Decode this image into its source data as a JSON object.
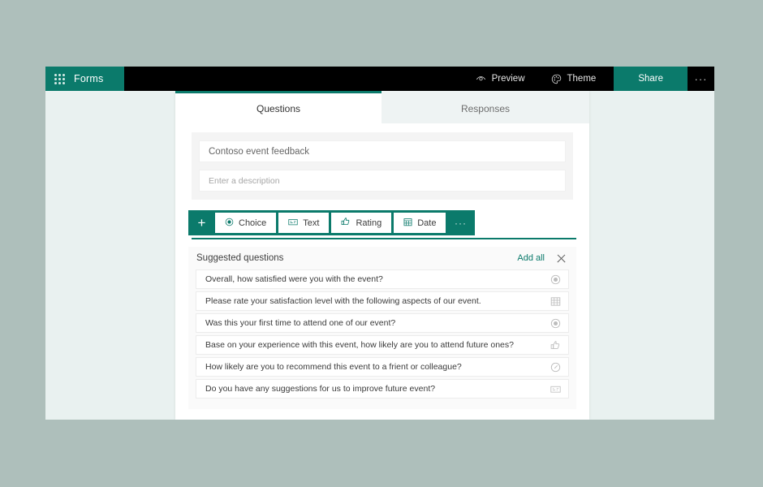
{
  "suite_bar": {
    "app_launcher_name": "waffle-icon",
    "brand": "Forms",
    "preview_label": "Preview",
    "theme_label": "Theme",
    "share_label": "Share",
    "more_label": "···"
  },
  "tabs": [
    {
      "label": "Questions",
      "active": true
    },
    {
      "label": "Responses",
      "active": false
    }
  ],
  "form": {
    "title": "Contoso event feedback",
    "description_placeholder": "Enter a description"
  },
  "question_toolbar": {
    "add_label": "+",
    "items": [
      {
        "label": "Choice",
        "icon": "radio-button-icon"
      },
      {
        "label": "Text",
        "icon": "text-box-icon"
      },
      {
        "label": "Rating",
        "icon": "thumbs-up-icon"
      },
      {
        "label": "Date",
        "icon": "calendar-icon"
      }
    ],
    "more_label": "···"
  },
  "suggested": {
    "title": "Suggested questions",
    "add_all_label": "Add all",
    "close_label": "close-icon",
    "questions": [
      {
        "text": "Overall, how satisfied were you with the event?",
        "icon": "radio-button-icon"
      },
      {
        "text": "Please rate your satisfaction level with the following aspects of our event.",
        "icon": "grid-icon"
      },
      {
        "text": "Was this your first time to attend one of our event?",
        "icon": "radio-button-icon"
      },
      {
        "text": "Base on your experience with this event, how likely are you to attend future ones?",
        "icon": "thumbs-up-icon"
      },
      {
        "text": "How likely are you to recommend this event to a frient or colleague?",
        "icon": "gauge-icon"
      },
      {
        "text": "Do you have any suggestions for us to improve future event?",
        "icon": "text-box-icon"
      }
    ]
  },
  "colors": {
    "teal": "#0b7a6b",
    "suite_bar": "#000000",
    "page_background": "#aebfbb",
    "app_background": "#e9f1f0"
  }
}
